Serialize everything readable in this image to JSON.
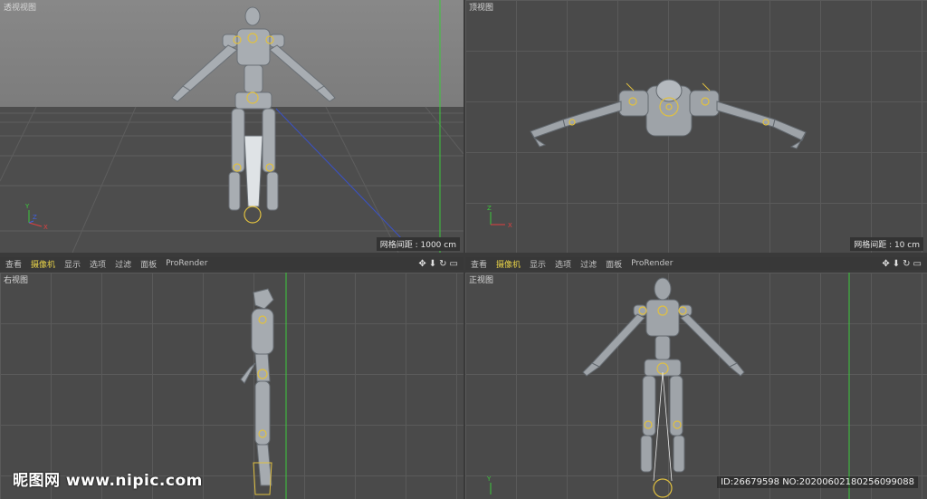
{
  "viewports": {
    "perspective": {
      "label": "透视视图",
      "grid_info": "网格间距 : 1000 cm"
    },
    "top": {
      "label": "顶视图",
      "grid_info": "网格间距 : 10 cm"
    },
    "right": {
      "label": "右视图"
    },
    "front": {
      "label": "正视图"
    }
  },
  "toolbar": {
    "items": [
      {
        "label": "查看",
        "active": false
      },
      {
        "label": "摄像机",
        "active": true
      },
      {
        "label": "显示",
        "active": false
      },
      {
        "label": "选项",
        "active": false
      },
      {
        "label": "过滤",
        "active": false
      },
      {
        "label": "面板",
        "active": false
      },
      {
        "label": "ProRender",
        "active": false
      }
    ],
    "icons": [
      "move-icon",
      "down-arrow-icon",
      "rotate-icon",
      "maximize-icon"
    ]
  },
  "watermark": {
    "left": "昵图网 www.nipic.com",
    "right": "ID:26679598 NO:20200602180256099088"
  },
  "colors": {
    "accent_yellow": "#e8d248",
    "axis_green": "#3cc83c",
    "axis_red": "#e04040",
    "axis_blue": "#4060e0",
    "joint_yellow": "#e0c040"
  }
}
